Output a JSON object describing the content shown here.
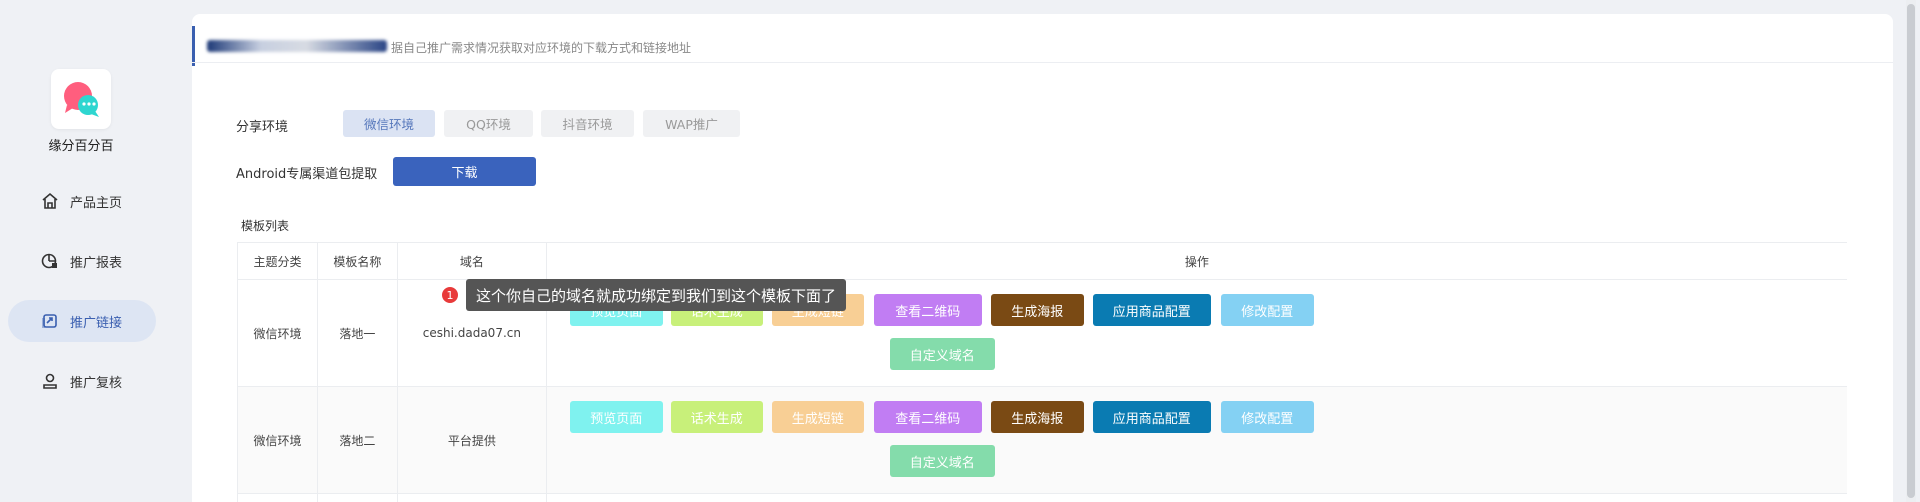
{
  "brand": {
    "name": "缘分百分百",
    "logo_colors": [
      "#ff5e7e",
      "#2ed6d0"
    ]
  },
  "sidebar": {
    "items": [
      {
        "label": "产品主页",
        "icon": "home-icon",
        "active": false
      },
      {
        "label": "推广报表",
        "icon": "report-icon",
        "active": false
      },
      {
        "label": "推广链接",
        "icon": "link-icon",
        "active": true
      },
      {
        "label": "推广复核",
        "icon": "user-check-icon",
        "active": false
      }
    ]
  },
  "tip": {
    "text": "据自己推广需求情况获取对应环境的下载方式和链接地址"
  },
  "share_env": {
    "label": "分享环境",
    "options": [
      "微信环境",
      "QQ环境",
      "抖音环境",
      "WAP推广"
    ],
    "selected": "微信环境"
  },
  "android": {
    "label": "Android专属渠道包提取",
    "button": "下载"
  },
  "template_list": {
    "title": "模板列表",
    "headers": [
      "主题分类",
      "模板名称",
      "域名",
      "操作"
    ],
    "rows": [
      {
        "category": "微信环境",
        "name": "落地一",
        "domain": "ceshi.dada07.cn"
      },
      {
        "category": "微信环境",
        "name": "落地二",
        "domain": "平台提供"
      }
    ],
    "actions": [
      {
        "label": "预览页面",
        "color": "#7ff2ef"
      },
      {
        "label": "话术生成",
        "color": "#c8f07a"
      },
      {
        "label": "生成短链",
        "color": "#f8cf95"
      },
      {
        "label": "查看二维码",
        "color": "#c17df3"
      },
      {
        "label": "生成海报",
        "color": "#7a4a14"
      },
      {
        "label": "应用商品配置",
        "color": "#0a7bb2"
      },
      {
        "label": "修改配置",
        "color": "#84d1f3"
      },
      {
        "label": "自定义域名",
        "color": "#84dcab"
      }
    ]
  },
  "tooltip": {
    "badge": "1",
    "text": "这个你自己的域名就成功绑定到我们到这个模板下面了"
  },
  "colors": {
    "accent": "#3a63bd",
    "active_nav_bg": "#dde5f3"
  }
}
